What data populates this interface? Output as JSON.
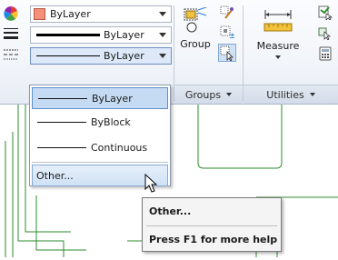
{
  "ribbon": {
    "properties": {
      "color_value": "ByLayer",
      "lineweight_value": "ByLayer",
      "linetype_value": "ByLayer",
      "color_swatch": "#f4907a"
    },
    "groups_panel": {
      "group_button_label": "Group",
      "panel_title": "Groups"
    },
    "utilities_panel": {
      "measure_button_label": "Measure",
      "panel_title": "Utilities"
    }
  },
  "linetype_dropdown": {
    "items": [
      {
        "label": "ByLayer"
      },
      {
        "label": "ByBlock"
      },
      {
        "label": "Continuous"
      }
    ],
    "other_label": "Other..."
  },
  "tooltip": {
    "title": "Other...",
    "help": "Press F1 for more help"
  },
  "colors": {
    "drawing_lines": "#2e8b2e",
    "highlight": "#c5dbf3"
  }
}
